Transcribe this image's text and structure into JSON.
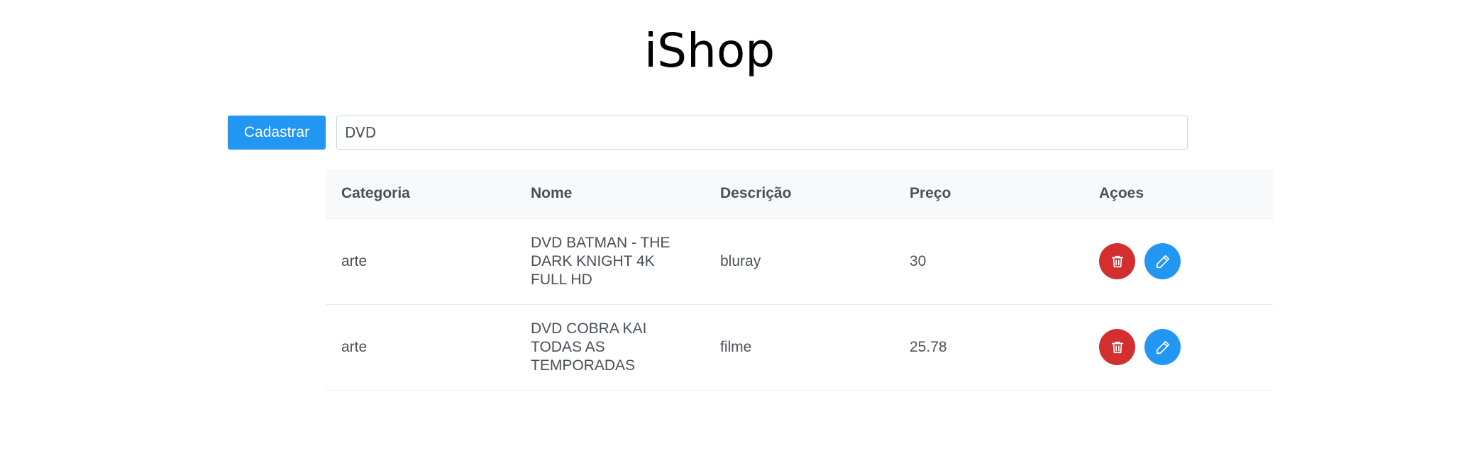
{
  "header": {
    "title": "iShop"
  },
  "toolbar": {
    "register_label": "Cadastrar",
    "search_value": "DVD"
  },
  "table": {
    "columns": [
      "Categoria",
      "Nome",
      "Descrição",
      "Preço",
      "Açoes"
    ],
    "rows": [
      {
        "categoria": "arte",
        "nome": "DVD BATMAN - THE DARK KNIGHT 4K FULL HD",
        "descricao": "bluray",
        "preco": "30"
      },
      {
        "categoria": "arte",
        "nome": "DVD COBRA KAI TODAS AS TEMPORADAS",
        "descricao": "filme",
        "preco": "25.78"
      }
    ],
    "row_actions": [
      "trash-icon",
      "pencil-icon"
    ]
  },
  "colors": {
    "primary": "#2196f3",
    "danger": "#d32f2f",
    "header_bg": "#f8f9fa"
  }
}
